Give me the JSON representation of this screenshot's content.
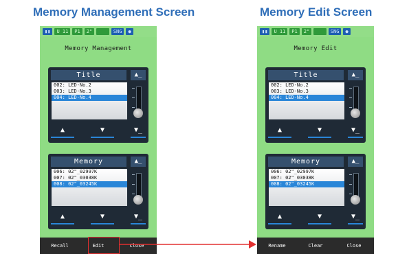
{
  "captions": {
    "left": "Memory Management Screen",
    "right": "Memory Edit Screen"
  },
  "status_bar": [
    "U 11",
    "P1",
    "2\"",
    "SNG"
  ],
  "left_screen": {
    "title": "Memory Management",
    "title_panel": {
      "header": "Title",
      "items": [
        "002: LED-No.2",
        "003: LED-No.3",
        "004: LED-No.4"
      ],
      "selected_index": 2
    },
    "memory_panel": {
      "header": "Memory",
      "items": [
        "006: 02\"_02997K",
        "007: 02\"_03038K",
        "008: 02\"_03245K"
      ],
      "selected_index": 2
    },
    "buttons": [
      "Recall",
      "Edit",
      "Close"
    ]
  },
  "right_screen": {
    "title": "Memory Edit",
    "title_panel": {
      "header": "Title",
      "items": [
        "002: LED-No.2",
        "003: LED-No.3",
        "004: LED-No.4"
      ],
      "selected_index": 2
    },
    "memory_panel": {
      "header": "Memory",
      "items": [
        "006: 02\"_02997K",
        "007: 02\"_03038K",
        "008: 02\"_03245K"
      ],
      "selected_index": 2
    },
    "buttons": [
      "Rename",
      "Clear",
      "Close"
    ]
  },
  "glyphs": {
    "scroll_top": "▲̲",
    "up": "▲",
    "down": "▼",
    "scroll_bottom": "▼̲"
  },
  "colors": {
    "caption": "#2f6eb8",
    "device_bg": "#8fdc84",
    "selection": "#2a86d8",
    "highlight": "#e23030"
  }
}
